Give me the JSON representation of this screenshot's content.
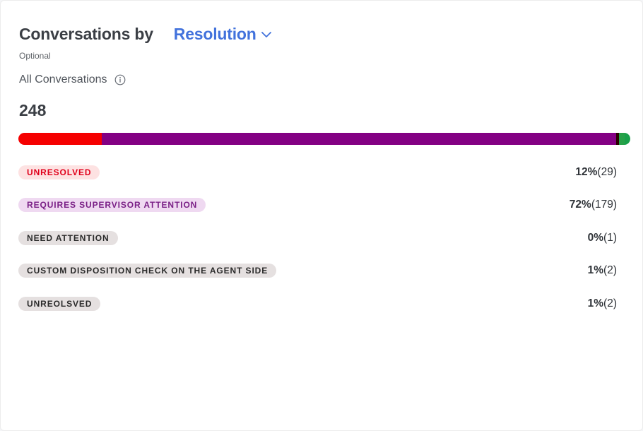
{
  "header": {
    "title": "Conversations by",
    "selector_label": "Resolution",
    "optional_label": "Optional"
  },
  "summary": {
    "label": "All Conversations",
    "total": "248"
  },
  "dispositions": [
    {
      "label": "UNRESOLVED",
      "percent": "12%",
      "count": "(29)",
      "value": 29,
      "color": "#f50000",
      "badge_bg": "#fde2e2",
      "badge_fg": "#e0001b"
    },
    {
      "label": "REQUIRES SUPERVISOR ATTENTION",
      "percent": "72%",
      "count": "(179)",
      "value": 179,
      "color": "#830083",
      "badge_bg": "#efd9f1",
      "badge_fg": "#7a1f86"
    },
    {
      "label": "NEED ATTENTION",
      "percent": "0%",
      "count": "(1)",
      "value": 1,
      "color": "#2b0000",
      "badge_bg": "#e5e0e0",
      "badge_fg": "#2a2a2a"
    },
    {
      "label": "CUSTOM DISPOSITION CHECK ON THE AGENT SIDE",
      "percent": "1%",
      "count": "(2)",
      "value": 2,
      "color": "#26a148",
      "badge_bg": "#e5e0e0",
      "badge_fg": "#2a2a2a"
    },
    {
      "label": "UNREOLSVED",
      "percent": "1%",
      "count": "(2)",
      "value": 2,
      "color": "#18a04a",
      "badge_bg": "#e5e0e0",
      "badge_fg": "#2a2a2a"
    }
  ],
  "colors": {
    "accent": "#4272dc",
    "title_text": "#3b3f45"
  }
}
